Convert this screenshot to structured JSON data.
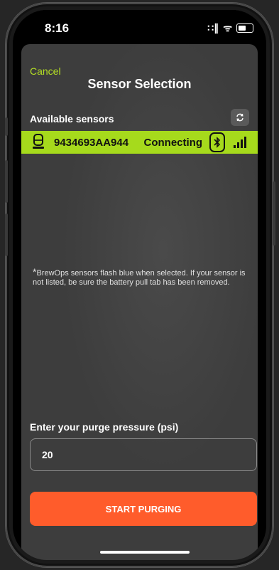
{
  "status_bar": {
    "time": "8:16",
    "signal_glyph": "∷∥",
    "wifi_glyph": "ᯤ"
  },
  "header": {
    "cancel_label": "Cancel",
    "title": "Sensor Selection"
  },
  "sensors": {
    "section_label": "Available sensors",
    "refresh_icon": "refresh-icon",
    "items": [
      {
        "id": "9434693AA944",
        "status": "Connecting",
        "icon": "sensor-device-icon",
        "bt_icon": "bluetooth-icon"
      }
    ],
    "highlight_color": "#a6da1c"
  },
  "note": {
    "star": "*",
    "text": "BrewOps sensors flash blue when selected. If your sensor is not listed, be sure  the battery pull tab has been removed."
  },
  "pressure": {
    "label": "Enter your purge pressure (psi)",
    "value": "20"
  },
  "actions": {
    "start_label": "START PURGING",
    "start_color": "#ff5c2b"
  },
  "theme": {
    "accent": "#b5e024"
  }
}
